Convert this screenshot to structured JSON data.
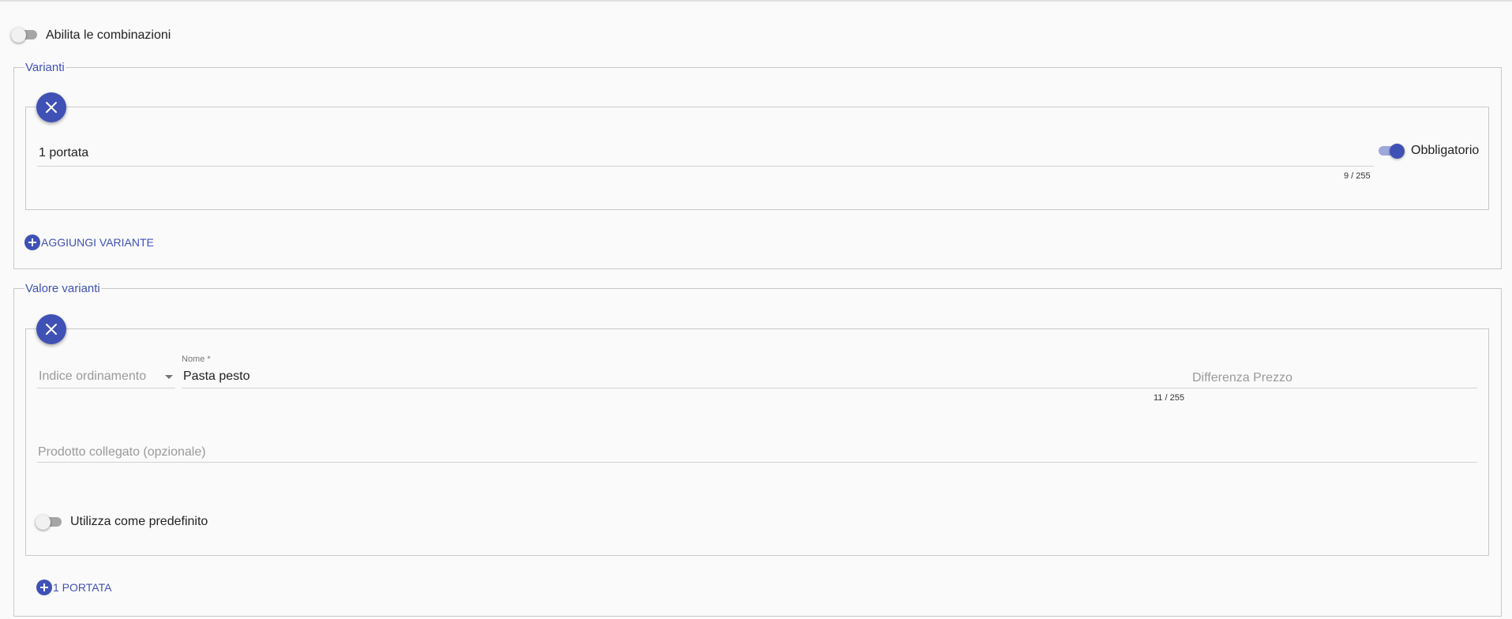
{
  "combinations": {
    "label": "Abilita le combinazioni",
    "enabled": false
  },
  "variants_section": {
    "legend": "Varianti",
    "variant": {
      "name_value": "1 portata",
      "char_counter": "9 / 255",
      "mandatory_label": "Obbligatorio",
      "mandatory": true,
      "remove_icon": "close-icon"
    },
    "add_button_label": "AGGIUNGI VARIANTE",
    "add_icon": "plus-circle-icon"
  },
  "values_section": {
    "legend": "Valore varianti",
    "value": {
      "sort_index_placeholder": "Indice ordinamento",
      "name_label": "Nome *",
      "name_value": "Pasta pesto",
      "name_counter": "11 / 255",
      "price_diff_placeholder": "Differenza Prezzo",
      "linked_product_placeholder": "Prodotto collegato (opzionale)",
      "default_label": "Utilizza come predefinito",
      "is_default": false,
      "remove_icon": "close-icon"
    },
    "add_button_label": "1 PORTATA",
    "add_icon": "plus-circle-icon"
  },
  "colors": {
    "primary": "#3f51b5",
    "primary_light": "#9fa8da",
    "border": "#c8c8c8",
    "background": "#fafafa"
  }
}
